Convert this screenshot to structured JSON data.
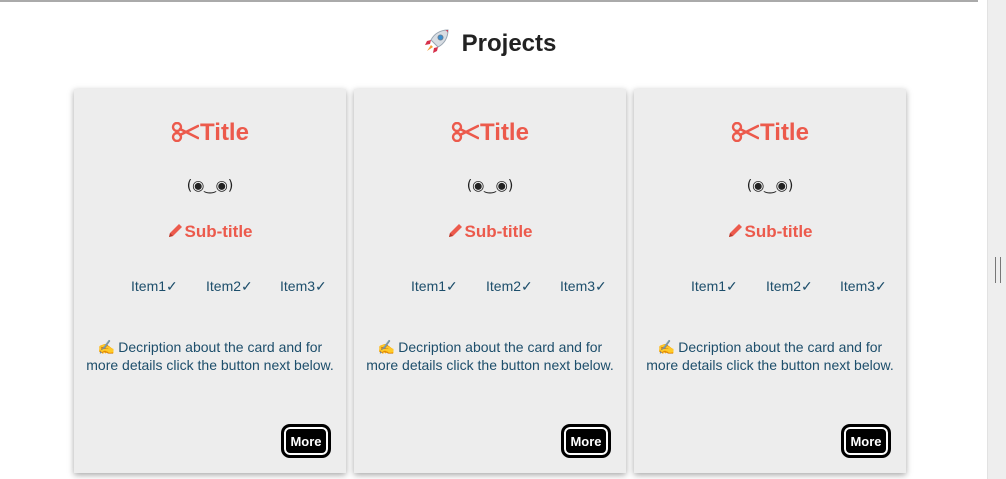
{
  "section": {
    "title": "Projects",
    "icon": "rocket-icon"
  },
  "cards": [
    {
      "title": "Title",
      "title_icon": "scissors-icon",
      "face": "(◉‿◉)",
      "subtitle": "Sub-title",
      "subtitle_icon": "pencil-icon",
      "items": [
        "Item1✓",
        "Item2✓",
        "Item3✓"
      ],
      "description_icon": "writing-hand-icon",
      "description": "Decription about the card and for more details click the button next below.",
      "button_label": "More"
    },
    {
      "title": "Title",
      "title_icon": "scissors-icon",
      "face": "(◉‿◉)",
      "subtitle": "Sub-title",
      "subtitle_icon": "pencil-icon",
      "items": [
        "Item1✓",
        "Item2✓",
        "Item3✓"
      ],
      "description_icon": "writing-hand-icon",
      "description": "Decription about the card and for more details click the button next below.",
      "button_label": "More"
    },
    {
      "title": "Title",
      "title_icon": "scissors-icon",
      "face": "(◉‿◉)",
      "subtitle": "Sub-title",
      "subtitle_icon": "pencil-icon",
      "items": [
        "Item1✓",
        "Item2✓",
        "Item3✓"
      ],
      "description_icon": "writing-hand-icon",
      "description": "Decription about the card and for more details click the button next below.",
      "button_label": "More"
    }
  ],
  "colors": {
    "accent": "#ec5a4c",
    "text": "#1d4e6b",
    "card_bg": "#ededed",
    "button_bg": "#000000"
  }
}
